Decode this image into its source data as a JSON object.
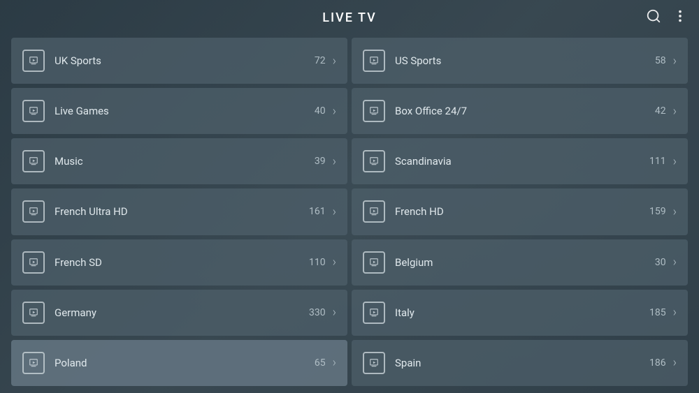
{
  "header": {
    "title": "LIVE TV",
    "search_icon": "search-icon",
    "more_icon": "more-icon"
  },
  "grid_items": [
    {
      "id": "uk-sports",
      "label": "UK Sports",
      "count": "72",
      "highlighted": false
    },
    {
      "id": "us-sports",
      "label": "US Sports",
      "count": "58",
      "highlighted": false
    },
    {
      "id": "live-games",
      "label": "Live Games",
      "count": "40",
      "highlighted": false
    },
    {
      "id": "box-office",
      "label": "Box Office 24/7",
      "count": "42",
      "highlighted": false
    },
    {
      "id": "music",
      "label": "Music",
      "count": "39",
      "highlighted": false
    },
    {
      "id": "scandinavia",
      "label": "Scandinavia",
      "count": "111",
      "highlighted": false
    },
    {
      "id": "french-ultra-hd",
      "label": "French Ultra HD",
      "count": "161",
      "highlighted": false
    },
    {
      "id": "french-hd",
      "label": "French HD",
      "count": "159",
      "highlighted": false
    },
    {
      "id": "french-sd",
      "label": "French SD",
      "count": "110",
      "highlighted": false
    },
    {
      "id": "belgium",
      "label": "Belgium",
      "count": "30",
      "highlighted": false
    },
    {
      "id": "germany",
      "label": "Germany",
      "count": "330",
      "highlighted": false
    },
    {
      "id": "italy",
      "label": "Italy",
      "count": "185",
      "highlighted": false
    },
    {
      "id": "poland",
      "label": "Poland",
      "count": "65",
      "highlighted": true
    },
    {
      "id": "spain",
      "label": "Spain",
      "count": "186",
      "highlighted": false
    }
  ]
}
